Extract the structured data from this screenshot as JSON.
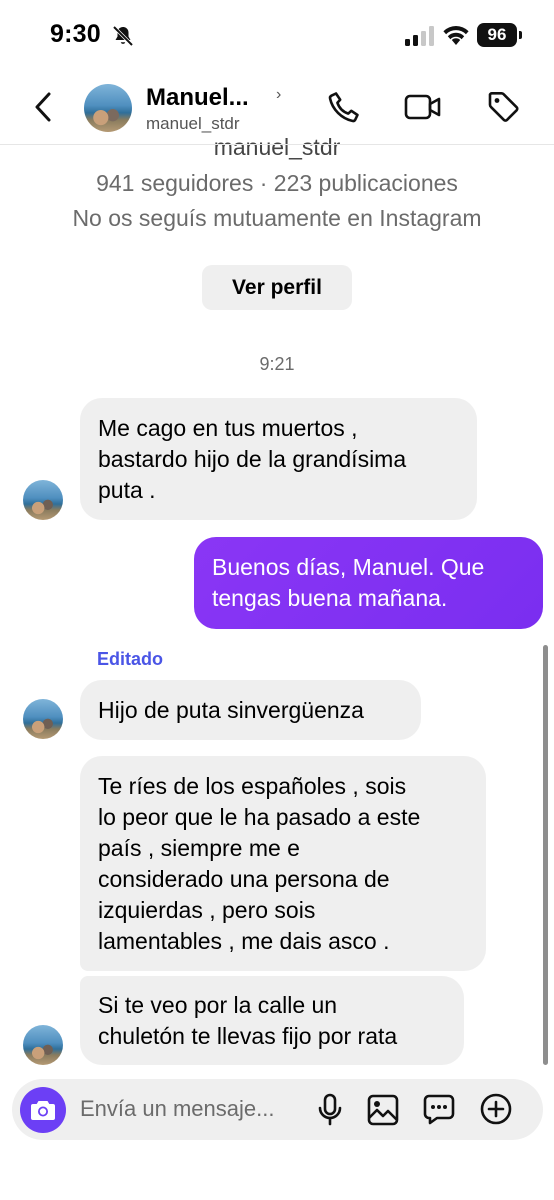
{
  "status_bar": {
    "time": "9:30",
    "battery": "96",
    "icons": [
      "bell-slash-icon",
      "signal-icon",
      "wifi-icon",
      "battery-icon"
    ]
  },
  "header": {
    "contact_name": "Manuel...",
    "chevron": "›",
    "username": "manuel_stdr",
    "icons": [
      "back-icon",
      "avatar",
      "phone-icon",
      "video-icon",
      "tag-icon"
    ]
  },
  "profile": {
    "username_partial": "manuel_stdr",
    "stats": "941 seguidores · 223 publicaciones",
    "mutual": "No os seguís mutuamente en Instagram",
    "view_profile_label": "Ver perfil"
  },
  "conversation": {
    "timestamp": "9:21",
    "edited_label": "Editado",
    "messages": [
      {
        "direction": "incoming",
        "lines": [
          "Me cago en tus muertos  ,",
          "bastardo hijo de la grandísima",
          "puta ."
        ]
      },
      {
        "direction": "outgoing",
        "lines": [
          "Buenos días, Manuel. Que",
          "tengas buena mañana."
        ]
      },
      {
        "direction": "incoming",
        "lines": [
          "Hijo de puta sinvergüenza"
        ]
      },
      {
        "direction": "incoming",
        "lines": [
          "Te ríes de los españoles , sois",
          "lo peor que le ha pasado a este",
          "país , siempre me e",
          "considerado una persona de",
          "izquierdas , pero sois",
          "lamentables , me dais asco ."
        ]
      },
      {
        "direction": "incoming",
        "lines": [
          "Si te veo por la calle un",
          "chuletón te llevas fijo por rata"
        ]
      }
    ]
  },
  "composer": {
    "placeholder": "Envía un mensaje...",
    "icons": [
      "camera-icon",
      "mic-icon",
      "gallery-icon",
      "sticker-icon",
      "plus-icon"
    ]
  },
  "colors": {
    "outgoing_bubble": "#7a2ef0",
    "incoming_bubble": "#efefef",
    "edited_label": "#4a55e6",
    "camera_button": "#6c3ff5"
  }
}
